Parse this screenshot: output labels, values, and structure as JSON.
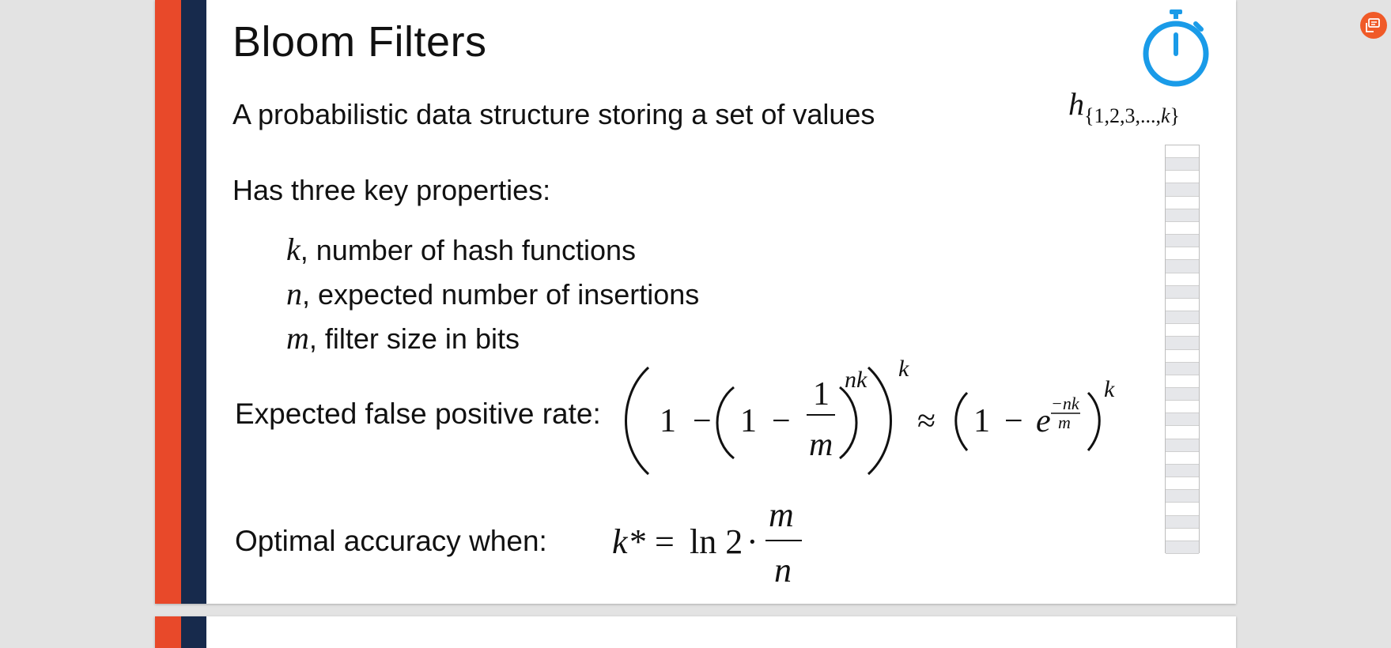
{
  "colors": {
    "accent_orange": "#e8492a",
    "accent_navy": "#172a4c",
    "stopwatch_blue": "#1a9be8",
    "bit_cell_fill": "#e6e7ea",
    "badge": "#f05a28"
  },
  "slide": {
    "title": "Bloom Filters",
    "subtitle": "A probabilistic data structure storing a set of values",
    "hash_symbol": "h",
    "hash_subscript_prefix": "{1,2,3,...,",
    "hash_subscript_var": "k",
    "hash_subscript_suffix": "}",
    "properties_heading": "Has three key properties:",
    "properties": [
      {
        "symbol": "k",
        "text": ", number of hash functions"
      },
      {
        "symbol": "n",
        "text": ", expected number of insertions"
      },
      {
        "symbol": "m",
        "text": ", filter size in bits"
      }
    ],
    "fpr_label": "Expected false positive rate:",
    "opt_label": "Optimal accuracy when:",
    "bit_array_cells": 32
  },
  "icons": {
    "stopwatch": "stopwatch-icon",
    "badge": "comment-icon"
  }
}
